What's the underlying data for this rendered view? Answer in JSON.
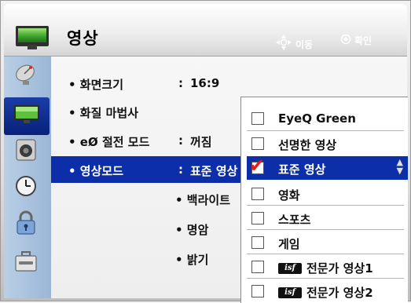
{
  "header": {
    "title": "영상",
    "hint_move": "이동",
    "hint_ok": "확인"
  },
  "sidebar": {
    "items": [
      {
        "name": "satellite-dish-icon"
      },
      {
        "name": "tv-screen-icon",
        "selected": true
      },
      {
        "name": "speaker-icon"
      },
      {
        "name": "clock-icon"
      },
      {
        "name": "lock-icon"
      },
      {
        "name": "toolbox-icon"
      }
    ]
  },
  "menu": {
    "items": [
      {
        "label": "• 화면크기",
        "colon": ":",
        "value": "16:9"
      },
      {
        "label": "• 화질 마법사",
        "colon": "",
        "value": ""
      },
      {
        "label": "• eØ 절전 모드",
        "colon": ":",
        "value": "꺼짐"
      },
      {
        "label": "• 영상모드",
        "colon": ":",
        "value": "표준 영상",
        "selected": true
      }
    ],
    "sub_items": [
      "• 백라이트",
      "• 명암",
      "• 밝기"
    ]
  },
  "popup": {
    "options": [
      {
        "label": "EyeQ Green"
      },
      {
        "label": "선명한 영상"
      },
      {
        "label": "표준 영상",
        "selected": true,
        "checked": true
      },
      {
        "label": "영화"
      },
      {
        "label": "스포츠"
      },
      {
        "label": "게임"
      },
      {
        "label": "전문가 영상1",
        "badge": "isf"
      },
      {
        "label": "전문가 영상2",
        "badge": "isf"
      }
    ]
  },
  "colors": {
    "selection_blue": "#0c2ea8",
    "sidebar_blue": "#9ab6d6",
    "check_red": "#e21b1b"
  }
}
